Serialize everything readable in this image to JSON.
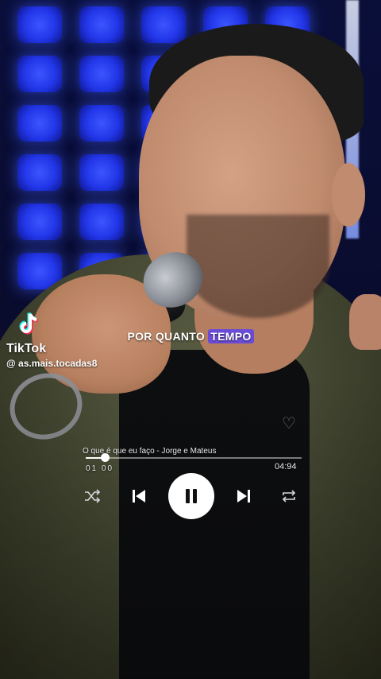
{
  "caption": {
    "before": "POR QUANTO ",
    "highlight": "TEMPO"
  },
  "watermark": {
    "brand": "TikTok",
    "handle": "@ as.mais.tocadas8"
  },
  "player": {
    "song_title": "O que é que eu faço - Jorge e Mateus",
    "current_time": "01 00",
    "total_time": "04:94",
    "progress_fraction": 0.09,
    "state": "playing",
    "controls": [
      "shuffle-icon",
      "previous-icon",
      "pause-icon",
      "next-icon",
      "repeat-icon"
    ]
  },
  "colors": {
    "highlight": "#6b4cd8",
    "led": "#2236e8",
    "jacket": "#4a4d35"
  }
}
